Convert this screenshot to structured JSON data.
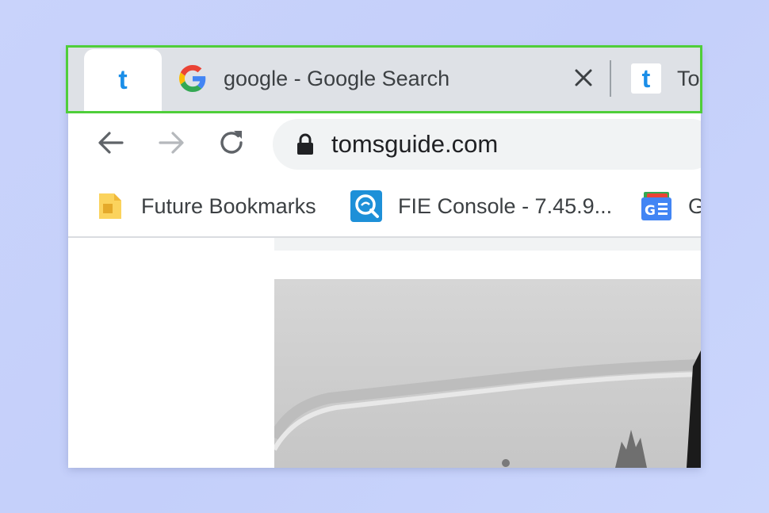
{
  "tabs": {
    "active_tab_icon": "t",
    "google_tab": {
      "icon": "google-g-icon",
      "title": "google - Google Search",
      "close_glyph": "✕"
    },
    "third_tab": {
      "icon": "t",
      "title": "To"
    }
  },
  "toolbar": {
    "back_icon": "arrow-left-icon",
    "forward_icon": "arrow-right-icon",
    "reload_icon": "reload-icon",
    "url": "tomsguide.com"
  },
  "bookmarks": [
    {
      "icon": "folder-icon",
      "label": "Future Bookmarks"
    },
    {
      "icon": "fie-icon",
      "label": "FIE Console - 7.45.9..."
    },
    {
      "icon": "google-news-icon",
      "label": "G"
    }
  ],
  "colors": {
    "highlight": "#4fce3a",
    "brand_t": "#1a8ee8",
    "background": "#c6d1fb"
  }
}
